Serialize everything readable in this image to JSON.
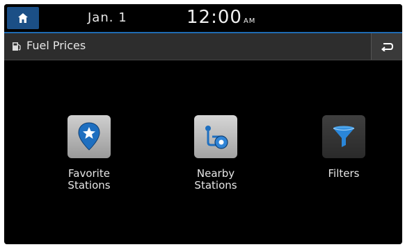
{
  "status_bar": {
    "date": "Jan. 1",
    "time": "12:00",
    "ampm": "AM"
  },
  "title_bar": {
    "title": "Fuel Prices",
    "title_icon": "fuel-pump-icon",
    "back_icon": "back-arrow-icon"
  },
  "menu": {
    "items": [
      {
        "label_line1": "Favorite",
        "label_line2": "Stations",
        "icon": "favorite-location-pin-icon"
      },
      {
        "label_line1": "Nearby",
        "label_line2": "Stations",
        "icon": "nearby-route-icon"
      },
      {
        "label_line1": "Filters",
        "label_line2": "",
        "icon": "funnel-filter-icon"
      }
    ]
  },
  "colors": {
    "screen_bg": "#000000",
    "accent_blue": "#1b4f86",
    "divider_blue": "#1f6bb3",
    "titlebar_bg": "#2d2d2d"
  }
}
